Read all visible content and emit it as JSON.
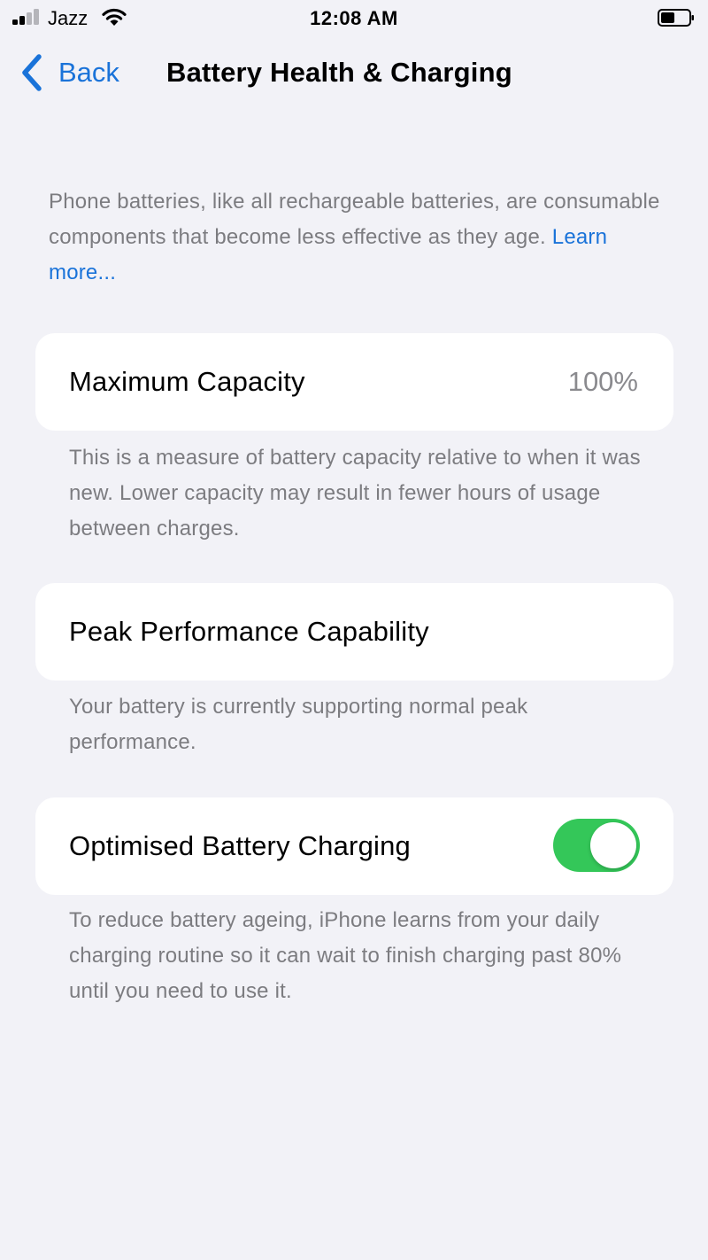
{
  "status_bar": {
    "carrier": "Jazz",
    "time": "12:08 AM",
    "signal_bars_active": 2,
    "signal_bars_total": 4,
    "battery_level": 0.5,
    "wifi_icon": "wifi-icon",
    "battery_icon": "battery-icon"
  },
  "nav": {
    "back_label": "Back",
    "back_icon": "chevron-left-icon",
    "title": "Battery Health & Charging"
  },
  "intro": {
    "text": "Phone batteries, like all rechargeable batteries, are consumable components that become less effective as they age. ",
    "link_label": "Learn more..."
  },
  "maximum_capacity": {
    "label": "Maximum Capacity",
    "value": "100%",
    "footnote": "This is a measure of battery capacity relative to when it was new. Lower capacity may result in fewer hours of usage between charges."
  },
  "peak_performance": {
    "label": "Peak Performance Capability",
    "footnote": "Your battery is currently supporting normal peak performance."
  },
  "optimised_charging": {
    "label": "Optimised Battery Charging",
    "enabled": true,
    "footnote": "To reduce battery ageing, iPhone learns from your daily charging routine so it can wait to finish charging past 80% until you need to use it."
  },
  "colors": {
    "background": "#f2f2f7",
    "accent": "#1a73d9",
    "toggle_on": "#34c759",
    "secondary_text": "#7c7c80"
  }
}
